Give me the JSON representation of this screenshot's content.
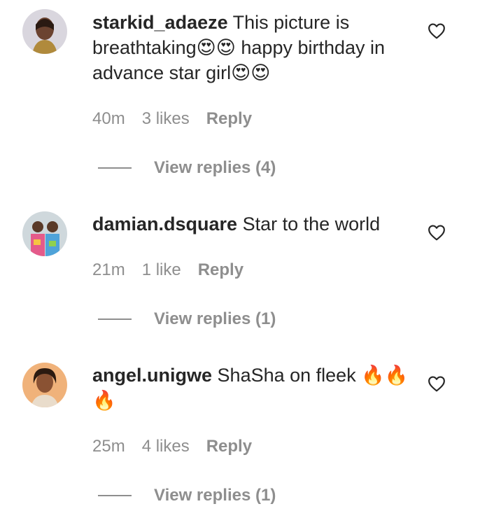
{
  "comments": [
    {
      "username": "starkid_adaeze",
      "text": "This picture is breathtaking😍😍 happy birthday in advance star girl😍😍",
      "time": "40m",
      "likes": "3 likes",
      "reply_label": "Reply",
      "view_replies": "View replies (4)"
    },
    {
      "username": "damian.dsquare",
      "text": "Star to the world",
      "time": "21m",
      "likes": "1 like",
      "reply_label": "Reply",
      "view_replies": "View replies (1)"
    },
    {
      "username": "angel.unigwe",
      "text": "ShaSha on fleek 🔥🔥🔥",
      "time": "25m",
      "likes": "4 likes",
      "reply_label": "Reply",
      "view_replies": "View replies (1)"
    }
  ],
  "icons": {
    "like": "heart-outline-icon"
  },
  "colors": {
    "text": "#262626",
    "secondary": "#8e8e8e"
  }
}
